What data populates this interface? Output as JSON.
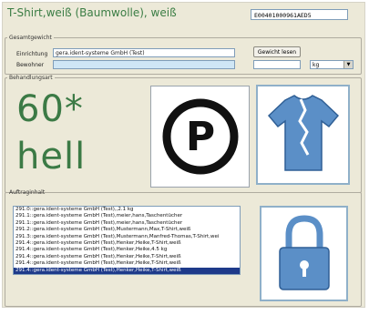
{
  "title": "T-Shirt,weiß (Baumwolle), weiß",
  "code": "E00401000961AED5",
  "gesamtgewicht": {
    "legend": "Gesamtgewicht",
    "einrichtung_label": "Einrichtung",
    "einrichtung_value": "gera.ident-systeme GmbH (Test)",
    "bewohner_label": "Bewohner",
    "bewohner_value": "",
    "button_label": "Gewicht lesen",
    "weight_value": "",
    "unit_value": "kg"
  },
  "behandlungsart": {
    "legend": "Behandlungsart",
    "temp": "60*",
    "mode": "hell"
  },
  "auftraginhalt": {
    "legend": "Auftraginhalt",
    "rows": [
      "291.0::gera.ident-systeme GmbH (Test),,2.1 kg",
      "291.1::gera.ident-systeme GmbH (Test),meier,hans,Taschentücher",
      "291.1::gera.ident-systeme GmbH (Test),meier,hans,Taschentücher",
      "291.2::gera.ident-systeme GmbH (Test),Mustermann,Max,T-Shirt,weiß",
      "291.3::gera.ident-systeme GmbH (Test),Mustermann,Manfred-Thomas,T-Shirt,wei",
      "291.4::gera.ident-systeme GmbH (Test),Henker,Heike,T-Shirt,weiß",
      "291.4::gera.ident-systeme GmbH (Test),Henker,Heike,4.5 kg",
      "291.4::gera.ident-systeme GmbH (Test),Henker,Heike,T-Shirt,weiß",
      "291.4::gera.ident-systeme GmbH (Test),Henker,Heike,T-Shirt,weiß",
      "291.4::gera.ident-systeme GmbH (Test),Henker,Heike,T-Shirt,weiß"
    ],
    "selected_index": 9
  },
  "icons": {
    "dryclean": "dry-clean-p-icon",
    "shirt": "torn-shirt-icon",
    "lock": "padlock-icon"
  },
  "colors": {
    "accent_green": "#3b7a45",
    "icon_blue": "#5b8fc7",
    "selection": "#1e3a8a"
  }
}
